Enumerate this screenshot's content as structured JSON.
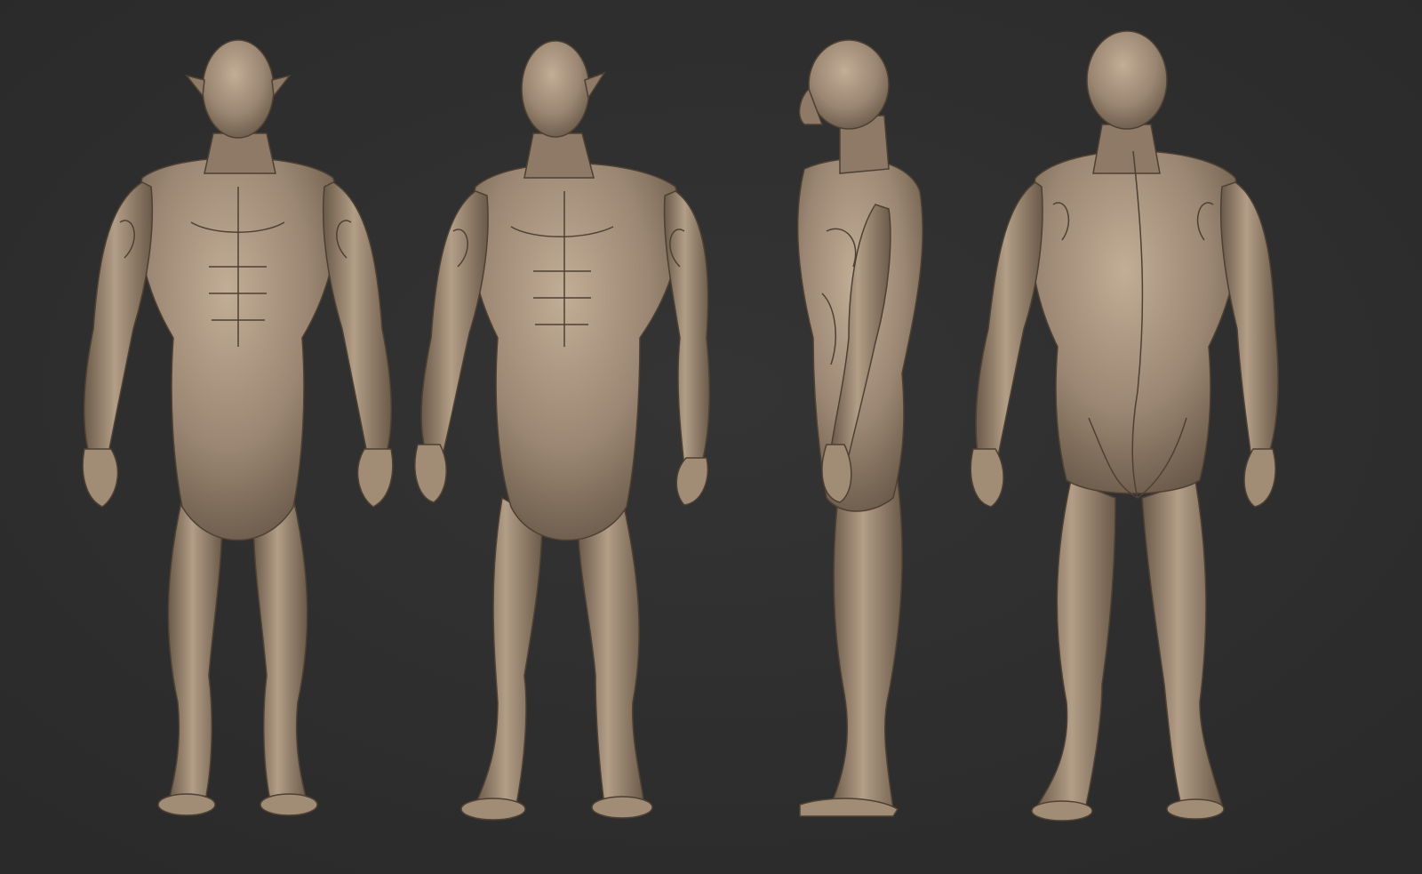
{
  "scene": {
    "background": "#2f2f2f",
    "skin": "#9a8672",
    "skin_light": "#c2ad96",
    "skin_shadow": "#5f5040",
    "vein": "#4e4033"
  },
  "figures": [
    {
      "view": "front",
      "name": "figure-front-view"
    },
    {
      "view": "three-quarter",
      "name": "figure-three-quarter-view"
    },
    {
      "view": "side",
      "name": "figure-side-view"
    },
    {
      "view": "back",
      "name": "figure-back-view"
    }
  ]
}
